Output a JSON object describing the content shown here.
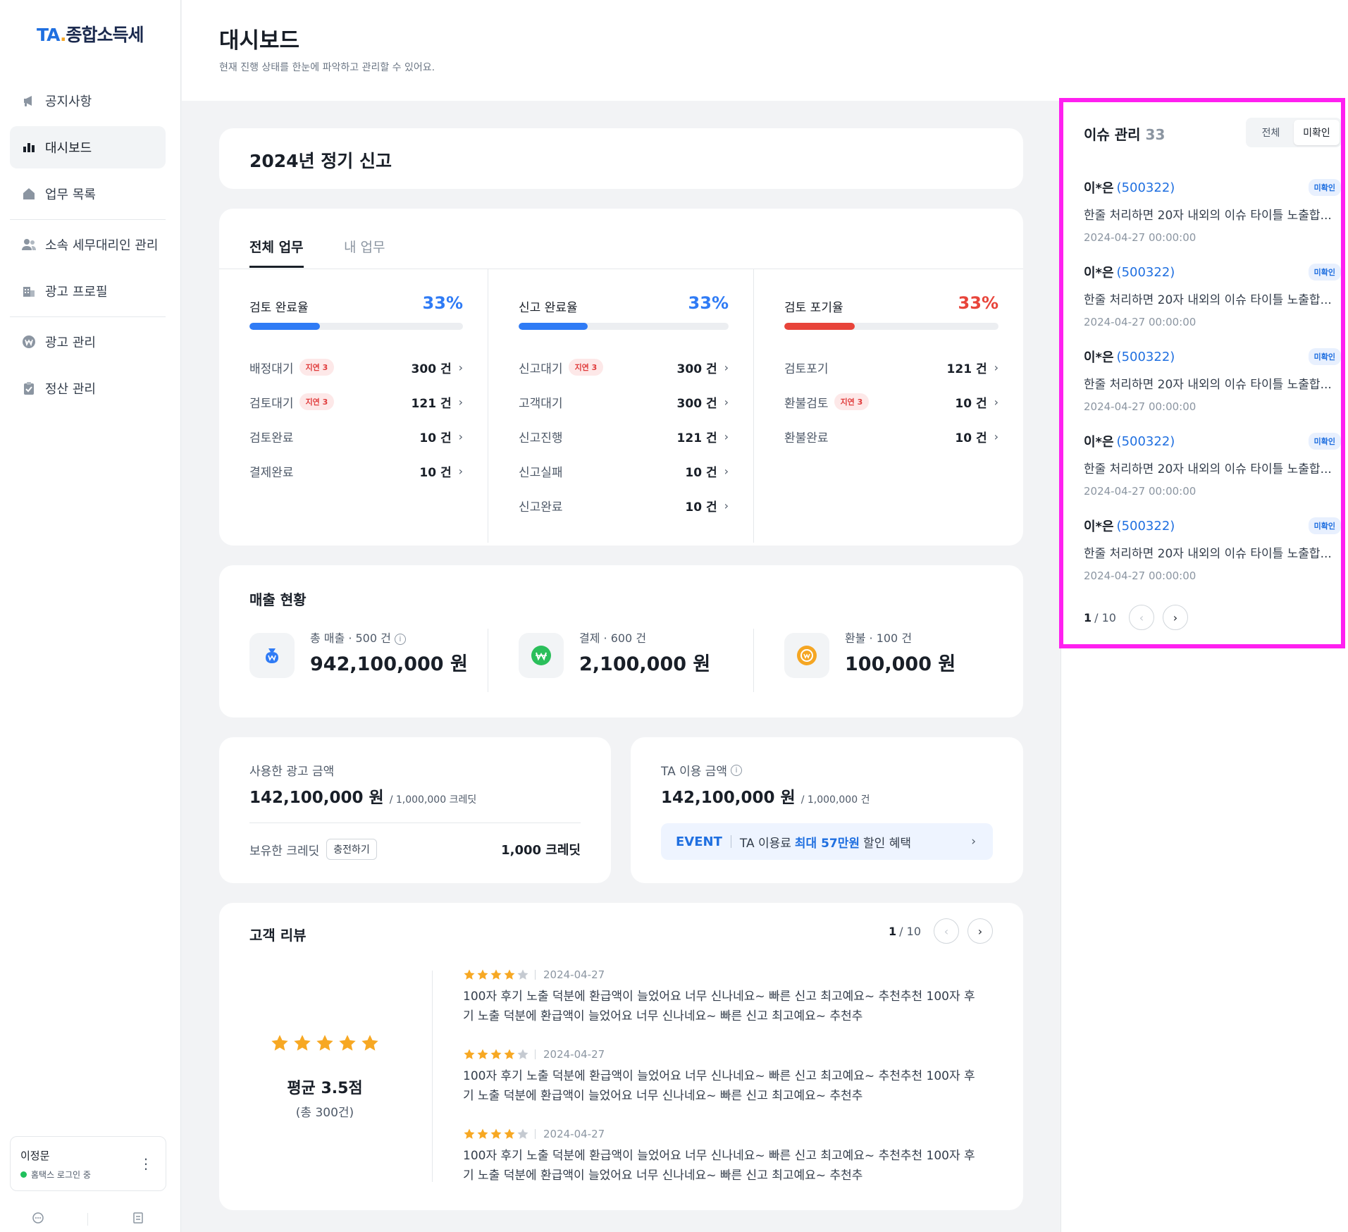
{
  "logo": {
    "ta": "TA",
    "dot": ".",
    "rest": "종합소득세"
  },
  "sidebar": {
    "items": [
      {
        "label": "공지사항",
        "icon": "megaphone-icon"
      },
      {
        "label": "대시보드",
        "icon": "bar-chart-icon",
        "active": true
      },
      {
        "label": "업무 목록",
        "icon": "home-icon"
      },
      {
        "label": "소속 세무대리인 관리",
        "icon": "people-icon"
      },
      {
        "label": "광고 프로필",
        "icon": "building-icon"
      },
      {
        "label": "광고 관리",
        "icon": "won-coin-icon"
      },
      {
        "label": "정산 관리",
        "icon": "clipboard-icon"
      }
    ],
    "user": {
      "name": "이정문",
      "status": "홈택스 로그인 중",
      "status_color": "#20c05c"
    }
  },
  "header": {
    "title": "대시보드",
    "subtitle": "현재 진행 상태를 한눈에 파악하고 관리할 수 있어요."
  },
  "filing": {
    "title": "2024년 정기 신고"
  },
  "work": {
    "tabs": [
      "전체 업무",
      "내 업무"
    ],
    "columns": [
      {
        "label": "검토 완료율",
        "percent": "33%",
        "progress": 0.33,
        "color": "#2f7bf5",
        "rows": [
          {
            "label": "배정대기",
            "badge": "지연 3",
            "value": "300 건"
          },
          {
            "label": "검토대기",
            "badge": "지연 3",
            "value": "121 건"
          },
          {
            "label": "검토완료",
            "badge": "",
            "value": "10 건"
          },
          {
            "label": "결제완료",
            "badge": "",
            "value": "10 건"
          }
        ]
      },
      {
        "label": "신고 완료율",
        "percent": "33%",
        "progress": 0.33,
        "color": "#2f7bf5",
        "rows": [
          {
            "label": "신고대기",
            "badge": "지연 3",
            "value": "300 건"
          },
          {
            "label": "고객대기",
            "badge": "",
            "value": "300 건"
          },
          {
            "label": "신고진행",
            "badge": "",
            "value": "121 건"
          },
          {
            "label": "신고실패",
            "badge": "",
            "value": "10 건"
          },
          {
            "label": "신고완료",
            "badge": "",
            "value": "10 건"
          }
        ]
      },
      {
        "label": "검토 포기율",
        "percent": "33%",
        "progress": 0.33,
        "color": "#e8443a",
        "rows": [
          {
            "label": "검토포기",
            "badge": "",
            "value": "121 건"
          },
          {
            "label": "환불검토",
            "badge": "지연 3",
            "value": "10 건"
          },
          {
            "label": "환불완료",
            "badge": "",
            "value": "10 건"
          }
        ]
      }
    ]
  },
  "sales": {
    "title": "매출 현황",
    "items": [
      {
        "label": "총 매출 · 500 건",
        "value": "942,100,000 원",
        "icon": "money-bag-icon",
        "color": "#2f7bf5"
      },
      {
        "label": "결제 · 600 건",
        "value": "2,100,000 원",
        "icon": "won-coin-icon",
        "color": "#2bbf5b"
      },
      {
        "label": "환불 · 100 건",
        "value": "100,000 원",
        "icon": "refund-coin-icon",
        "color": "#f5a623"
      }
    ]
  },
  "ad": {
    "label": "사용한 광고 금액",
    "amount": "142,100,000 원",
    "unit": "/ 1,000,000 크레딧",
    "credit_label": "보유한 크레딧",
    "charge_button": "충전하기",
    "credit_value": "1,000 크레딧"
  },
  "ta_fee": {
    "label": "TA 이용 금액",
    "amount": "142,100,000 원",
    "unit": "/ 1,000,000 건",
    "event_tag": "EVENT",
    "event_pre": "TA 이용료",
    "event_highlight": "최대 57만원",
    "event_post": "할인 혜택"
  },
  "reviews": {
    "title": "고객 리뷰",
    "page_current": "1",
    "page_total": "/ 10",
    "average_rating": 5,
    "average_text": "평균 3.5점",
    "total_count": "(총 300건)",
    "items": [
      {
        "rating": 4,
        "date": "2024-04-27",
        "line1": "100자 후기 노출 덕분에 환급액이 늘었어요 너무 신나네요~ 빠른 신고 최고예요~ 추천추천 100자 후",
        "line2": "기 노출 덕분에 환급액이 늘었어요 너무 신나네요~ 빠른 신고 최고예요~ 추천추"
      },
      {
        "rating": 4,
        "date": "2024-04-27",
        "line1": "100자 후기 노출 덕분에 환급액이 늘었어요 너무 신나네요~ 빠른 신고 최고예요~ 추천추천 100자 후",
        "line2": "기 노출 덕분에 환급액이 늘었어요 너무 신나네요~ 빠른 신고 최고예요~ 추천추"
      },
      {
        "rating": 4,
        "date": "2024-04-27",
        "line1": "100자 후기 노출 덕분에 환급액이 늘었어요 너무 신나네요~ 빠른 신고 최고예요~ 추천추천 100자 후",
        "line2": "기 노출 덕분에 환급액이 늘었어요 너무 신나네요~ 빠른 신고 최고예요~ 추천추"
      }
    ]
  },
  "issues": {
    "title": "이슈 관리",
    "count": "33",
    "filter_all": "전체",
    "filter_unread": "미확인",
    "page_current": "1",
    "page_total": "/ 10",
    "items": [
      {
        "name": "이*은",
        "id": "(500322)",
        "badge": "미확인",
        "text": "한줄 처리하면 20자 내외의 이슈 타이틀 노출합...",
        "date": "2024-04-27 00:00:00"
      },
      {
        "name": "이*은",
        "id": "(500322)",
        "badge": "미확인",
        "text": "한줄 처리하면 20자 내외의 이슈 타이틀 노출합...",
        "date": "2024-04-27 00:00:00"
      },
      {
        "name": "이*은",
        "id": "(500322)",
        "badge": "미확인",
        "text": "한줄 처리하면 20자 내외의 이슈 타이틀 노출합...",
        "date": "2024-04-27 00:00:00"
      },
      {
        "name": "이*은",
        "id": "(500322)",
        "badge": "미확인",
        "text": "한줄 처리하면 20자 내외의 이슈 타이틀 노출합...",
        "date": "2024-04-27 00:00:00"
      },
      {
        "name": "이*은",
        "id": "(500322)",
        "badge": "미확인",
        "text": "한줄 처리하면 20자 내외의 이슈 타이틀 노출합...",
        "date": "2024-04-27 00:00:00"
      }
    ]
  }
}
